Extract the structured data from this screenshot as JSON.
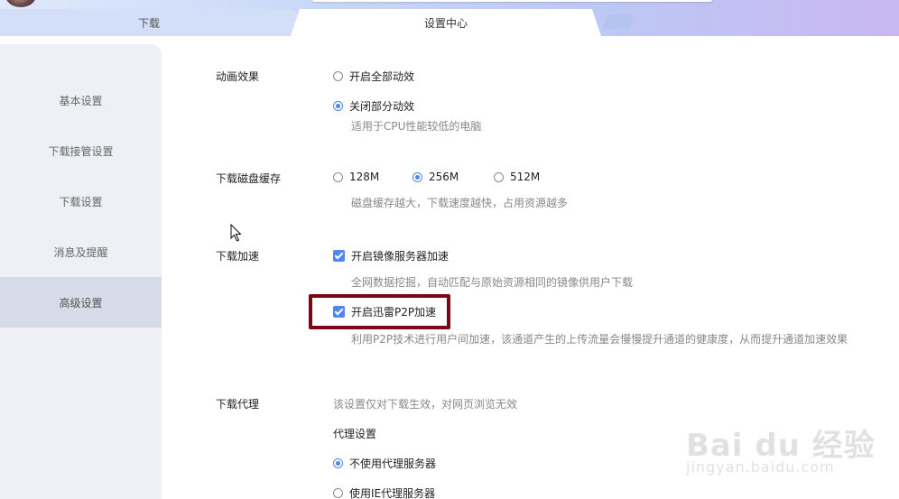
{
  "tabs": [
    {
      "label": "下载"
    },
    {
      "label": "设置中心"
    }
  ],
  "sidebar": {
    "items": [
      {
        "label": "基本设置"
      },
      {
        "label": "下载接管设置"
      },
      {
        "label": "下载设置"
      },
      {
        "label": "消息及提醒"
      },
      {
        "label": "高级设置",
        "active": true
      }
    ]
  },
  "animation": {
    "label": "动画效果",
    "options": [
      {
        "label": "开启全部动效",
        "selected": false
      },
      {
        "label": "关闭部分动效",
        "selected": true
      }
    ],
    "hint": "适用于CPU性能较低的电脑"
  },
  "disk_cache": {
    "label": "下载磁盘缓存",
    "options": [
      {
        "label": "128M",
        "selected": false
      },
      {
        "label": "256M",
        "selected": true
      },
      {
        "label": "512M",
        "selected": false
      }
    ],
    "hint": "磁盘缓存越大，下载速度越快，占用资源越多"
  },
  "acceleration": {
    "label": "下载加速",
    "mirror": {
      "label": "开启镜像服务器加速",
      "checked": true,
      "hint": "全网数据挖掘，自动匹配与原始资源相同的镜像供用户下载"
    },
    "p2p": {
      "label": "开启迅雷P2P加速",
      "checked": true,
      "hint": "利用P2P技术进行用户间加速，该通道产生的上传流量会慢慢提升通道的健康度，从而提升通道加速效果"
    }
  },
  "proxy": {
    "label": "下载代理",
    "hint": "该设置仅对下载生效，对网页浏览无效",
    "settings_title": "代理设置",
    "options": [
      {
        "label": "不使用代理服务器",
        "selected": true
      },
      {
        "label": "使用IE代理服务器",
        "selected": false
      }
    ]
  },
  "watermark": {
    "brand": "Bai du 经验",
    "url": "jingyan.baidu.com"
  },
  "colors": {
    "accent": "#4f86ef",
    "highlight_border": "#7c0618"
  }
}
